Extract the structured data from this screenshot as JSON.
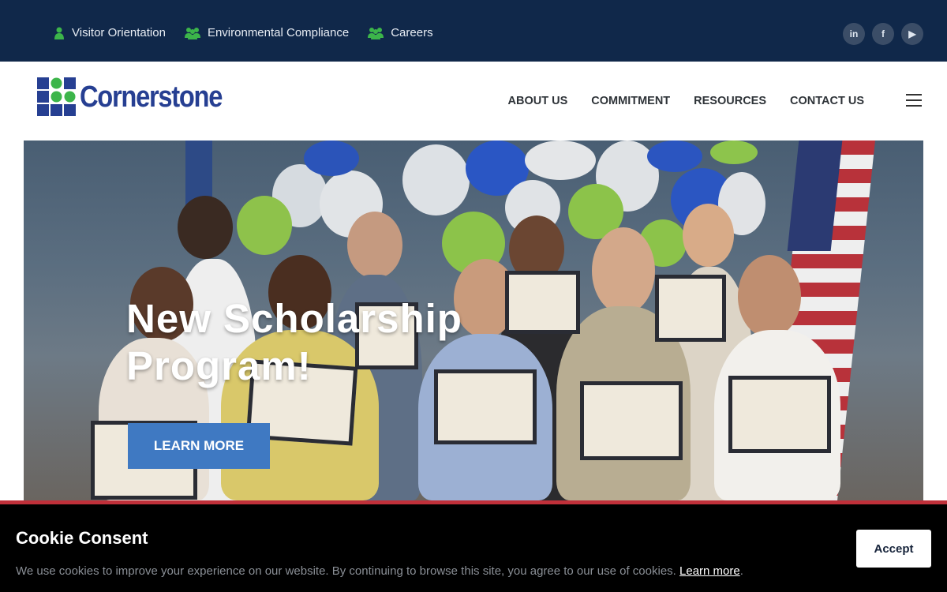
{
  "topbar": {
    "links": [
      {
        "label": "Visitor Orientation",
        "icon": "person-icon"
      },
      {
        "label": "Environmental Compliance",
        "icon": "users-icon"
      },
      {
        "label": "Careers",
        "icon": "users-icon"
      }
    ],
    "socials": [
      {
        "icon": "linkedin-icon",
        "glyph": "in"
      },
      {
        "icon": "facebook-icon",
        "glyph": "f"
      },
      {
        "icon": "youtube-icon",
        "glyph": "▶"
      }
    ]
  },
  "header": {
    "logo_text": "Cornerstone",
    "nav": [
      "ABOUT US",
      "COMMITMENT",
      "RESOURCES",
      "CONTACT US"
    ],
    "menu_icon": "hamburger-menu-icon"
  },
  "hero": {
    "title": "New Scholarship Program!",
    "button_label": "LEARN MORE"
  },
  "cookie": {
    "title": "Cookie Consent",
    "text": "We use cookies to improve your experience on our website. By continuing to browse this site, you agree to our use of cookies.",
    "link_label": "Learn more",
    "after_link": ".",
    "accept_label": "Accept"
  },
  "colors": {
    "topbar_bg": "#10284a",
    "brand_blue": "#263f92",
    "brand_green": "#3cb54a",
    "button_blue": "#3f79c2",
    "cookie_border": "#c0303a"
  }
}
